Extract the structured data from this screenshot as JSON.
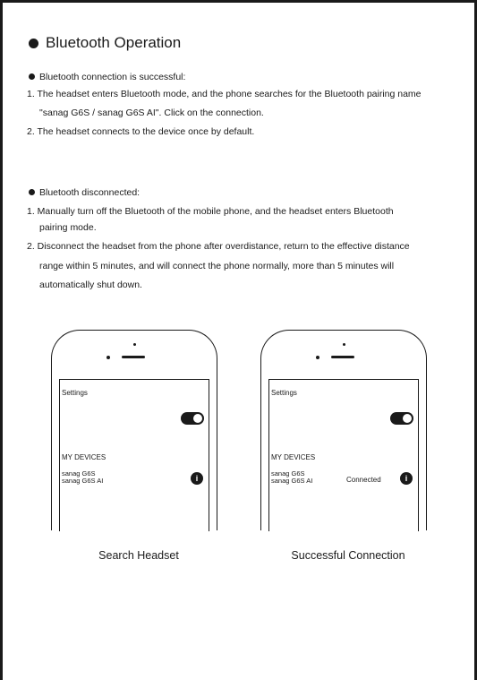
{
  "title": "Bluetooth Operation",
  "section1": {
    "heading": "Bluetooth connection is successful:",
    "lines": [
      "1. The headset enters Bluetooth mode, and the phone searches for the Bluetooth pairing name",
      "\"sanag G6S / sanag G6S AI\". Click on the connection.",
      "2. The headset connects to the device once by default."
    ]
  },
  "section2": {
    "heading": "Bluetooth disconnected:",
    "lines": [
      "1. Manually turn off the Bluetooth of the mobile phone, and the headset enters Bluetooth",
      "pairing mode.",
      "2. Disconnect the headset from the phone after overdistance, return to the effective distance",
      "range within 5 minutes, and will connect the phone normally, more than 5 minutes will",
      "automatically shut down."
    ]
  },
  "phones": [
    {
      "settings_label": "Settings",
      "my_devices_label": "MY DEVICES",
      "devices": [
        "sanag G6S",
        "sanag G6S AI"
      ],
      "status": "",
      "info_icon": "i",
      "caption": "Search Headset"
    },
    {
      "settings_label": "Settings",
      "my_devices_label": "MY DEVICES",
      "devices": [
        "sanag G6S",
        "sanag G6S AI"
      ],
      "status": "Connected",
      "info_icon": "i",
      "caption": "Successful Connection"
    }
  ]
}
